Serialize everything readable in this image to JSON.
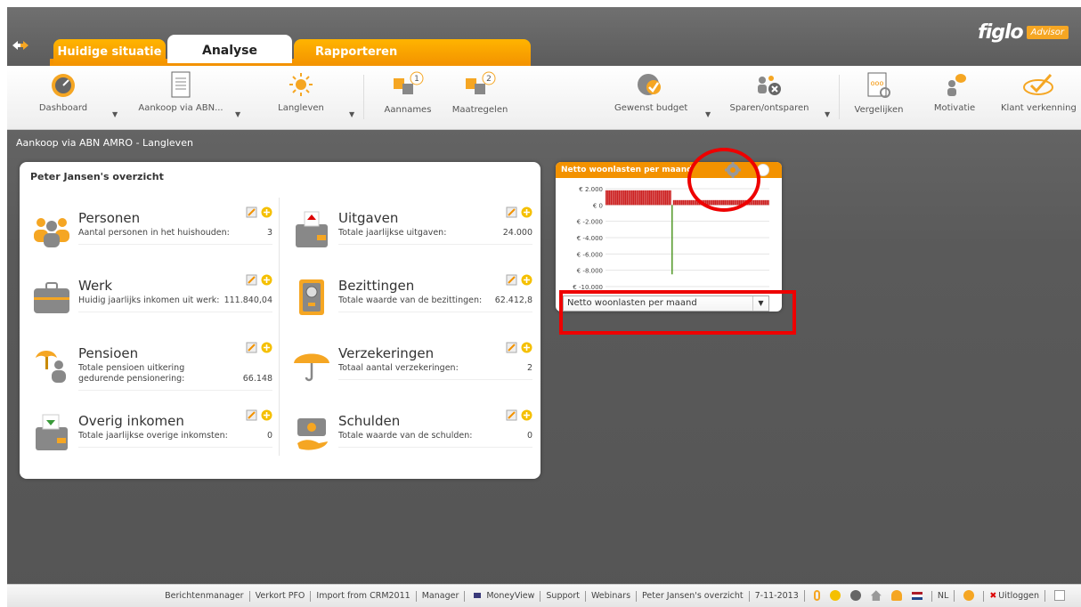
{
  "logo": {
    "brand": "figlo",
    "badge": "Advisor"
  },
  "tabs": [
    {
      "label": "Huidige situatie"
    },
    {
      "label": "Analyse"
    },
    {
      "label": "Rapporteren"
    }
  ],
  "toolbar": {
    "items": [
      {
        "label": "Dashboard",
        "icon": "dashboard-icon"
      },
      {
        "label": "Aankoop via ABN...",
        "icon": "document-icon"
      },
      {
        "label": "Langleven",
        "icon": "sun-icon"
      },
      {
        "label": "Aannames",
        "icon": "puzzle-1-icon",
        "badge": "1"
      },
      {
        "label": "Maatregelen",
        "icon": "puzzle-2-icon",
        "badge": "2"
      },
      {
        "label": "Gewenst budget",
        "icon": "budget-check-icon"
      },
      {
        "label": "Sparen/ontsparen",
        "icon": "savings-icon"
      },
      {
        "label": "Vergelijken",
        "icon": "compare-icon"
      },
      {
        "label": "Motivatie",
        "icon": "motivation-icon"
      },
      {
        "label": "Klant verkenning",
        "icon": "checkmark-icon"
      }
    ]
  },
  "breadcrumb": "Aankoop via ABN AMRO - Langleven",
  "overview": {
    "title": "Peter Jansen's overzicht",
    "items": [
      {
        "title": "Personen",
        "desc": "Aantal personen in het huishouden:",
        "value": "3"
      },
      {
        "title": "Uitgaven",
        "desc": "Totale jaarlijkse uitgaven:",
        "value": "24.000"
      },
      {
        "title": "Werk",
        "desc": "Huidig jaarlijks inkomen uit werk:",
        "value": "111.840,04"
      },
      {
        "title": "Bezittingen",
        "desc": "Totale waarde van de bezittingen:",
        "value": "62.412,8"
      },
      {
        "title": "Pensioen",
        "desc": "Totale pensioen uitkering gedurende pensionering:",
        "value": "66.148"
      },
      {
        "title": "Verzekeringen",
        "desc": "Totaal aantal verzekeringen:",
        "value": "2"
      },
      {
        "title": "Overig inkomen",
        "desc": "Totale jaarlijkse overige inkomsten:",
        "value": "0"
      },
      {
        "title": "Schulden",
        "desc": "Totale waarde van de schulden:",
        "value": "0"
      }
    ]
  },
  "widget": {
    "title": "Netto woonlasten per maand",
    "select_value": "Netto woonlasten per maand"
  },
  "chart_data": {
    "type": "bar",
    "title": "Netto woonlasten per maand",
    "y_tick_labels": [
      "€ 2.000",
      "€ 0",
      "€ -2.000",
      "€ -4.000",
      "€ -6.000",
      "€ -8.000",
      "€ -10.000"
    ],
    "ylim": [
      -10000,
      2000
    ],
    "grid": true,
    "series": [
      {
        "color": "#cc2222",
        "values_before": [
          1800,
          1800,
          1800,
          1800,
          1800,
          1800,
          1800,
          1800,
          1800,
          1800,
          1800,
          1800,
          1800,
          1800,
          1800,
          1800,
          1800,
          1800,
          1800,
          1800,
          1800,
          1800,
          1800,
          1800,
          1800,
          1800,
          1800,
          1800,
          1800,
          1800,
          1800,
          1800,
          1800,
          1800,
          1800,
          1800,
          1800,
          1800,
          1800,
          1800,
          1800
        ]
      },
      {
        "color": "#5a9e32",
        "spike": -8500
      },
      {
        "color": "#cc2222",
        "values_after": [
          600,
          600,
          600,
          600,
          600,
          600,
          600,
          600,
          600,
          600,
          600,
          600,
          600,
          600,
          600,
          600,
          600,
          600,
          600,
          600,
          600,
          600,
          600,
          600,
          600,
          600,
          600,
          600,
          600,
          600,
          600,
          600,
          600,
          600,
          600,
          600,
          600,
          600,
          600,
          600,
          600,
          600,
          600,
          600,
          600,
          600,
          600,
          600,
          600,
          600,
          600,
          600,
          600,
          600,
          600,
          600,
          600,
          600,
          600,
          600
        ]
      }
    ]
  },
  "status": {
    "links": [
      "Berichtenmanager",
      "Verkort PFO",
      "Import from CRM2011",
      "Manager",
      "MoneyView",
      "Support",
      "Webinars",
      "Peter Jansen's overzicht",
      "7-11-2013"
    ],
    "language": "NL",
    "logout": "Uitloggen"
  },
  "colors": {
    "accent": "#f39200",
    "highlight": "#e00000",
    "positive": "#cc2222",
    "negative": "#5a9e32"
  }
}
